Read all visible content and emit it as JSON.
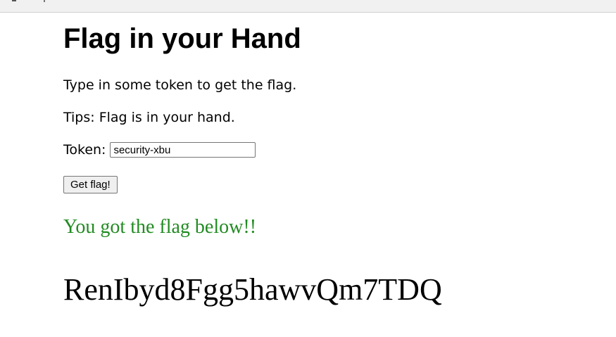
{
  "page": {
    "title": "Flag in your Hand",
    "instruction": "Type in some token to get the flag.",
    "tips": "Tips: Flag is in your hand."
  },
  "form": {
    "token_label": "Token:",
    "token_value": "security-xbu",
    "button_label": "Get flag!"
  },
  "result": {
    "success_message": "You got the flag below!!",
    "flag": "RenIbyd8Fgg5hawvQm7TDQ"
  },
  "colors": {
    "success": "#228b22",
    "text": "#000000"
  }
}
